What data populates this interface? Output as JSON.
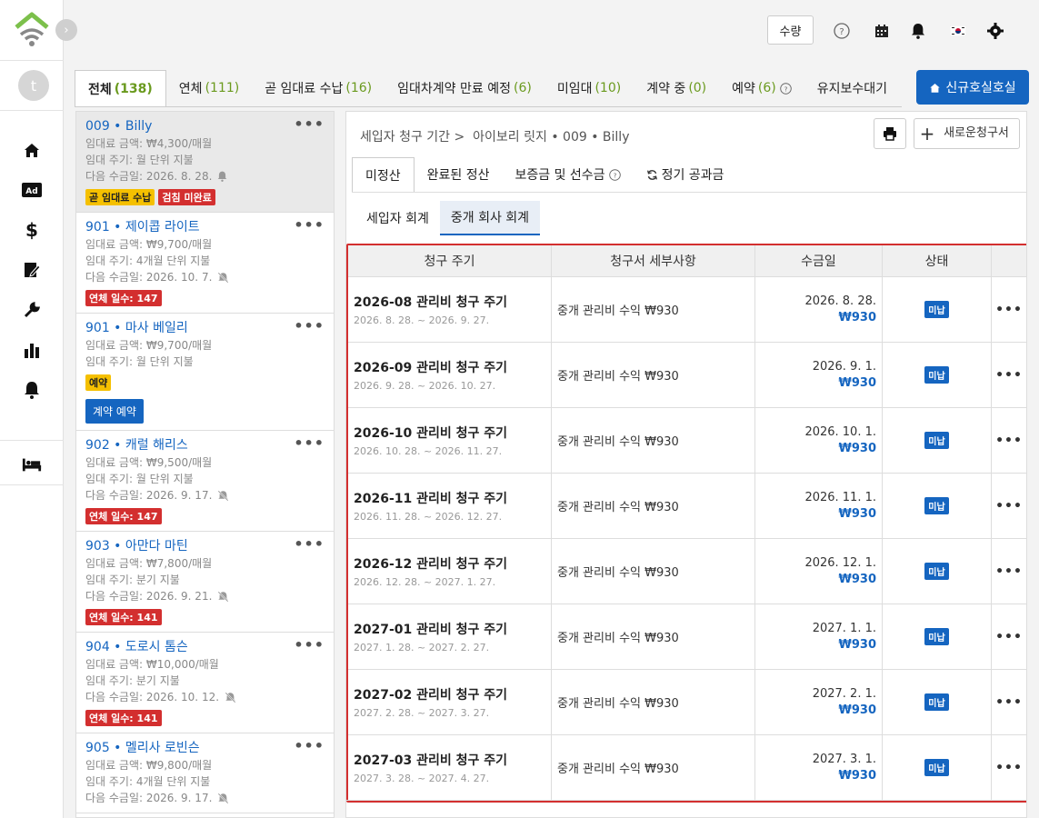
{
  "topbar": {
    "qty_label": "수량"
  },
  "tabs": [
    {
      "label": "전체",
      "count": "(138)"
    },
    {
      "label": "연체",
      "count": "(111)"
    },
    {
      "label": "곧 임대료 수납",
      "count": "(16)"
    },
    {
      "label": "임대차계약 만료 예정",
      "count": "(6)"
    },
    {
      "label": "미임대",
      "count": "(10)"
    },
    {
      "label": "계약 중",
      "count": "(0)"
    },
    {
      "label": "예약",
      "count": "(6)"
    },
    {
      "label": "유지보수대기 ",
      "count": ""
    }
  ],
  "new_room_label": "신규호실호실",
  "avatar_letter": "t",
  "list": [
    {
      "unit": "009",
      "name": "Billy",
      "rent": "임대료 금액: ₩4,300/매월",
      "cycle": "임대 주기: 월 단위 지불",
      "next": "다음 수금일:  2026. 8. 28.",
      "badges": [
        {
          "text": "곧 임대료 수납",
          "cls": "b-yellow"
        },
        {
          "text": "검침 미완료",
          "cls": "b-red"
        }
      ]
    },
    {
      "unit": "901",
      "name": "제이콥 라이트",
      "rent": "임대료 금액: ₩9,700/매월",
      "cycle": "임대 주기: 4개월 단위 지불",
      "next": "다음 수금일:  2026. 10. 7.",
      "badges": [
        {
          "text": "연체 일수: 147",
          "cls": "b-red"
        }
      ]
    },
    {
      "unit": "901",
      "name": "마사 베일리",
      "rent": "임대료 금액: ₩9,700/매월",
      "cycle": "임대 주기: 월 단위 지불",
      "next": "",
      "badges": [
        {
          "text": "예약",
          "cls": "b-yellow"
        }
      ],
      "button": "계약 예약"
    },
    {
      "unit": "902",
      "name": "캐럴 해리스",
      "rent": "임대료 금액: ₩9,500/매월",
      "cycle": "임대 주기: 월 단위 지불",
      "next": "다음 수금일:  2026. 9. 17.",
      "badges": [
        {
          "text": "연체 일수: 147",
          "cls": "b-red"
        }
      ]
    },
    {
      "unit": "903",
      "name": "아만다 마틴",
      "rent": "임대료 금액: ₩7,800/매월",
      "cycle": "임대 주기: 분기 지불",
      "next": "다음 수금일:  2026. 9. 21.",
      "badges": [
        {
          "text": "연체 일수: 141",
          "cls": "b-red"
        }
      ]
    },
    {
      "unit": "904",
      "name": "도로시 톰슨",
      "rent": "임대료 금액: ₩10,000/매월",
      "cycle": "임대 주기: 분기 지불",
      "next": "다음 수금일:  2026. 10. 12.",
      "badges": [
        {
          "text": "연체 일수: 141",
          "cls": "b-red"
        }
      ]
    },
    {
      "unit": "905",
      "name": "멜리사 로빈슨",
      "rent": "임대료 금액: ₩9,800/매월",
      "cycle": "임대 주기: 4개월 단위 지불",
      "next": "다음 수금일:  2026. 9. 17.",
      "badges": []
    }
  ],
  "detail": {
    "crumb_root": "세입자 청구 기간 >",
    "crumb_path": "아이보리 릿지 • 009 • Billy",
    "new_invoice_label": "새로운청구서",
    "subtabs": [
      "미정산",
      "완료된 정산",
      "보증금 및 선수금",
      "정기 공과금"
    ],
    "inner_tabs": [
      "세입자 회계",
      "중개 회사 회계"
    ],
    "headers": [
      "청구 주기",
      "청구서 세부사항",
      "수금일",
      "상태"
    ],
    "rows": [
      {
        "title": "2026-08 관리비 청구 주기",
        "range": "2026. 8. 28. ~ 2026. 9. 27.",
        "detail": "중개 관리비 수익  ₩930",
        "date": "2026. 8. 28.",
        "amount": "₩930",
        "status": "미납"
      },
      {
        "title": "2026-09 관리비 청구 주기",
        "range": "2026. 9. 28. ~ 2026. 10. 27.",
        "detail": "중개 관리비 수익  ₩930",
        "date": "2026. 9. 1.",
        "amount": "₩930",
        "status": "미납"
      },
      {
        "title": "2026-10 관리비 청구 주기",
        "range": "2026. 10. 28. ~ 2026. 11. 27.",
        "detail": "중개 관리비 수익  ₩930",
        "date": "2026. 10. 1.",
        "amount": "₩930",
        "status": "미납"
      },
      {
        "title": "2026-11 관리비 청구 주기",
        "range": "2026. 11. 28. ~ 2026. 12. 27.",
        "detail": "중개 관리비 수익  ₩930",
        "date": "2026. 11. 1.",
        "amount": "₩930",
        "status": "미납"
      },
      {
        "title": "2026-12 관리비 청구 주기",
        "range": "2026. 12. 28. ~ 2027. 1. 27.",
        "detail": "중개 관리비 수익  ₩930",
        "date": "2026. 12. 1.",
        "amount": "₩930",
        "status": "미납"
      },
      {
        "title": "2027-01 관리비 청구 주기",
        "range": "2027. 1. 28. ~ 2027. 2. 27.",
        "detail": "중개 관리비 수익  ₩930",
        "date": "2027. 1. 1.",
        "amount": "₩930",
        "status": "미납"
      },
      {
        "title": "2027-02 관리비 청구 주기",
        "range": "2027. 2. 28. ~ 2027. 3. 27.",
        "detail": "중개 관리비 수익  ₩930",
        "date": "2027. 2. 1.",
        "amount": "₩930",
        "status": "미납"
      },
      {
        "title": "2027-03 관리비 청구 주기",
        "range": "2027. 3. 28. ~ 2027. 4. 27.",
        "detail": "중개 관리비 수익  ₩930",
        "date": "2027. 3. 1.",
        "amount": "₩930",
        "status": "미납"
      }
    ]
  },
  "colors": {
    "accent": "#1565c0",
    "highlight": "#d32f2f",
    "count": "#6a9a1e"
  }
}
